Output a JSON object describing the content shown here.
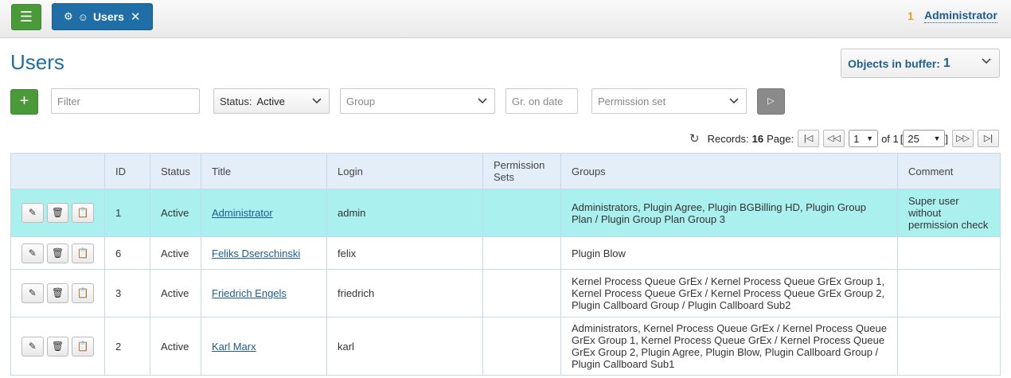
{
  "topbar": {
    "tab_label": "Users",
    "message_count": "1",
    "user_name": "Administrator"
  },
  "page": {
    "title": "Users",
    "buffer_label": "Objects in buffer:",
    "buffer_count": "1"
  },
  "filters": {
    "filter_placeholder": "Filter",
    "status_label": "Status:",
    "status_value": "Active",
    "group_placeholder": "Group",
    "date_placeholder": "Gr. on date",
    "permission_placeholder": "Permission set"
  },
  "pager": {
    "records_label": "Records:",
    "records_count": "16",
    "page_label": "Page:",
    "page_value": "1",
    "of_label": "of 1",
    "page_size": "25"
  },
  "table": {
    "columns": [
      "ID",
      "Status",
      "Title",
      "Login",
      "Permission Sets",
      "Groups",
      "Comment"
    ],
    "rows": [
      {
        "id": "1",
        "status": "Active",
        "title": "Administrator",
        "login": "admin",
        "permsets": "",
        "groups": "Administrators, Plugin Agree, Plugin BGBilling HD, Plugin Group Plan / Plugin Group Plan Group 3",
        "comment": "Super user without permission check"
      },
      {
        "id": "6",
        "status": "Active",
        "title": "Feliks Dserschinski",
        "login": "felix",
        "permsets": "",
        "groups": "Plugin Blow",
        "comment": ""
      },
      {
        "id": "3",
        "status": "Active",
        "title": "Friedrich Engels",
        "login": "friedrich",
        "permsets": "",
        "groups": "Kernel Process Queue GrEx / Kernel Process Queue GrEx Group 1, Kernel Process Queue GrEx / Kernel Process Queue GrEx Group 2, Plugin Callboard Group / Plugin Callboard Sub2",
        "comment": ""
      },
      {
        "id": "2",
        "status": "Active",
        "title": "Karl Marx",
        "login": "karl",
        "permsets": "",
        "groups": "Administrators, Kernel Process Queue GrEx / Kernel Process Queue GrEx Group 1, Kernel Process Queue GrEx / Kernel Process Queue GrEx Group 2, Plugin Agree, Plugin Blow, Plugin Callboard Group / Plugin Callboard Sub1",
        "comment": ""
      }
    ]
  }
}
